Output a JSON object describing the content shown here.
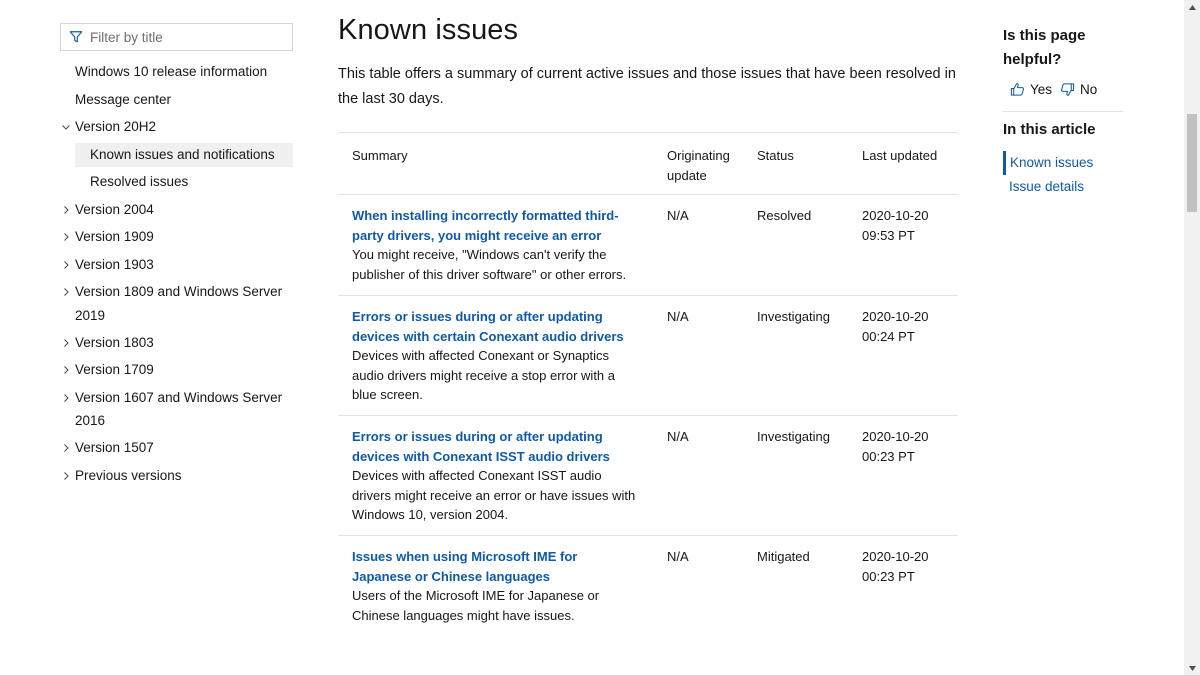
{
  "filter": {
    "placeholder": "Filter by title",
    "icon": "filter-icon"
  },
  "nav": {
    "items": [
      {
        "label": "Windows 10 release information"
      },
      {
        "label": "Message center"
      },
      {
        "label": "Version 20H2",
        "expanded": true
      },
      {
        "label": "Known issues and notifications",
        "active": true
      },
      {
        "label": "Resolved issues"
      },
      {
        "label": "Version 2004"
      },
      {
        "label": "Version 1909"
      },
      {
        "label": "Version 1903"
      },
      {
        "label": "Version 1809 and Windows Server 2019"
      },
      {
        "label": "Version 1803"
      },
      {
        "label": "Version 1709"
      },
      {
        "label": "Version 1607 and Windows Server 2016"
      },
      {
        "label": "Version 1507"
      },
      {
        "label": "Previous versions"
      }
    ]
  },
  "main": {
    "title": "Known issues",
    "intro": "This table offers a summary of current active issues and those issues that have been resolved in the last 30 days.",
    "table": {
      "headers": [
        "Summary",
        "Originating update",
        "Status",
        "Last updated"
      ],
      "rows": [
        {
          "title": "When installing incorrectly formatted third-party drivers, you might receive an error",
          "desc": "You might receive, \"Windows can't verify the publisher of this driver software\" or other errors.",
          "origin": "N/A",
          "status": "Resolved",
          "updated": "2020-10-20 09:53 PT"
        },
        {
          "title": "Errors or issues during or after updating devices with certain Conexant audio drivers",
          "desc": "Devices with affected Conexant or Synaptics audio drivers might receive a stop error with a blue screen.",
          "origin": "N/A",
          "status": "Investigating",
          "updated": "2020-10-20 00:24 PT"
        },
        {
          "title": "Errors or issues during or after updating devices with Conexant ISST audio drivers",
          "desc": "Devices with affected Conexant ISST audio drivers might receive an error or have issues with Windows 10, version 2004.",
          "origin": "N/A",
          "status": "Investigating",
          "updated": "2020-10-20 00:23 PT"
        },
        {
          "title": "Issues when using Microsoft IME for Japanese or Chinese languages",
          "desc": "Users of the Microsoft IME for Japanese or Chinese languages might have issues.",
          "origin": "N/A",
          "status": "Mitigated",
          "updated": "2020-10-20 00:23 PT"
        }
      ]
    }
  },
  "rail": {
    "helpful_title": "Is this page helpful?",
    "yes_label": "Yes",
    "no_label": "No",
    "in_article_title": "In this article",
    "toc": [
      {
        "label": "Known issues",
        "current": true
      },
      {
        "label": "Issue details"
      }
    ]
  },
  "colors": {
    "link": "#0f5aa8",
    "active_bg": "#f0f0f0",
    "border": "#e3e3e3"
  }
}
